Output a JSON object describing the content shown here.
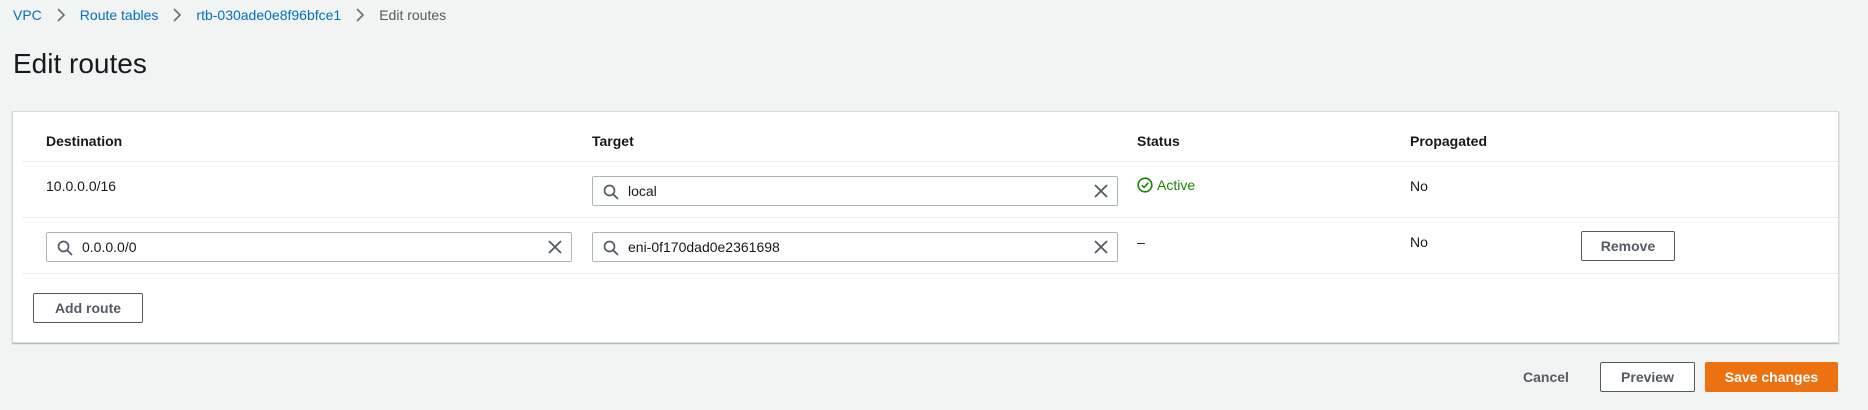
{
  "breadcrumb": {
    "items": [
      "VPC",
      "Route tables",
      "rtb-030ade0e8f96bfce1"
    ],
    "current": "Edit routes"
  },
  "page": {
    "title": "Edit routes"
  },
  "table": {
    "headers": {
      "destination": "Destination",
      "target": "Target",
      "status": "Status",
      "propagated": "Propagated"
    },
    "rows": [
      {
        "destination": "10.0.0.0/16",
        "target": "local",
        "status": "Active",
        "propagated": "No"
      },
      {
        "destination": "0.0.0.0/0",
        "target": "eni-0f170dad0e2361698",
        "status": "–",
        "propagated": "No",
        "remove_label": "Remove"
      }
    ],
    "add_route_label": "Add route"
  },
  "footer": {
    "cancel_label": "Cancel",
    "preview_label": "Preview",
    "save_label": "Save changes"
  },
  "colors": {
    "link": "#0073bb",
    "primary": "#ec7211",
    "success": "#1d8102",
    "background": "#f2f3f3"
  },
  "icons": {
    "separator": "chevron-right-icon",
    "search": "search-icon",
    "clear": "close-icon",
    "status_ok": "check-circle-icon"
  }
}
